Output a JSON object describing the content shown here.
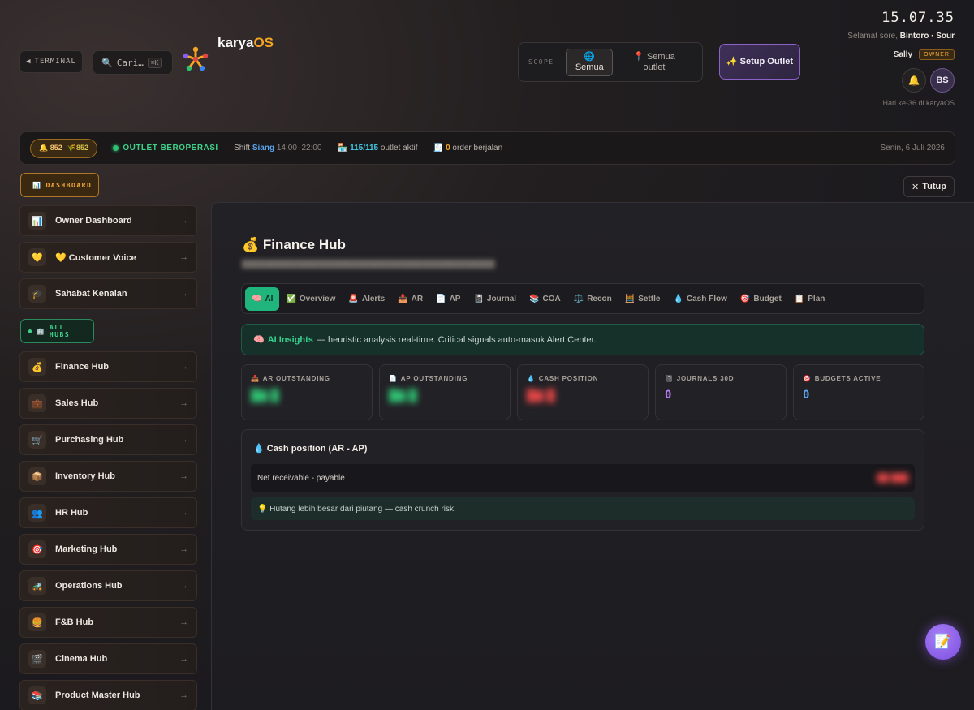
{
  "topbar": {
    "terminal_label": "TERMINAL",
    "terminal_icon": "◀",
    "search_placeholder": "Cari…",
    "search_shortcut": "⌘K",
    "brand_prefix": "karya",
    "brand_suffix": "OS",
    "scope": {
      "label": "SCOPE",
      "all_icon": "🌐",
      "all_label": "Semua",
      "outlet_icon": "📍",
      "outlet_label": "Semua outlet"
    },
    "setup_label": "✨ Setup Outlet",
    "clock": "15.07.35",
    "greeting_prefix": "Selamat sore,",
    "greeting_location": "Bintoro · Sour",
    "user_name": "Sally",
    "role_badge": "OWNER",
    "bell_icon": "🔔",
    "avatar_initials": "BS",
    "day_count": "Hari ke-36 di karyaOS"
  },
  "status": {
    "points_a": "🔔 852",
    "points_b": "🌾852",
    "operating": "OUTLET BEROPERASI",
    "shift_prefix": "Shift",
    "shift_name": "Siang",
    "shift_time": "14:00–22:00",
    "outlet_icon": "🏪",
    "outlet_count": "115/115",
    "outlet_suffix": "outlet aktif",
    "order_icon": "🧾",
    "order_count": "0",
    "order_suffix": "order berjalan",
    "date": "Senin, 6 Juli 2026"
  },
  "sidebar": {
    "dashboard_section": "DASHBOARD",
    "dashboard_section_icon": "📊",
    "dashboard_items": [
      {
        "icon": "📊",
        "label": "Owner Dashboard"
      },
      {
        "icon": "💛",
        "label": "💛 Customer Voice"
      },
      {
        "icon": "🎓",
        "label": "Sahabat Kenalan"
      }
    ],
    "hubs_section": "ALL HUBS",
    "hubs_section_icon": "🏢",
    "hubs": [
      {
        "icon": "💰",
        "label": "Finance Hub"
      },
      {
        "icon": "💼",
        "label": "Sales Hub"
      },
      {
        "icon": "🛒",
        "label": "Purchasing Hub"
      },
      {
        "icon": "📦",
        "label": "Inventory Hub"
      },
      {
        "icon": "👥",
        "label": "HR Hub"
      },
      {
        "icon": "🎯",
        "label": "Marketing Hub"
      },
      {
        "icon": "🚜",
        "label": "Operations Hub"
      },
      {
        "icon": "🍔",
        "label": "F&B Hub"
      },
      {
        "icon": "🎬",
        "label": "Cinema Hub"
      },
      {
        "icon": "📚",
        "label": "Product Master Hub"
      }
    ],
    "arrow": "→"
  },
  "main": {
    "close_label": "Tutup",
    "title": "💰 Finance Hub",
    "tabs": [
      {
        "icon": "🧠",
        "label": "AI"
      },
      {
        "icon": "✅",
        "label": "Overview"
      },
      {
        "icon": "🚨",
        "label": "Alerts"
      },
      {
        "icon": "📥",
        "label": "AR"
      },
      {
        "icon": "📄",
        "label": "AP"
      },
      {
        "icon": "📓",
        "label": "Journal"
      },
      {
        "icon": "📚",
        "label": "COA"
      },
      {
        "icon": "⚖️",
        "label": "Recon"
      },
      {
        "icon": "🧮",
        "label": "Settle"
      },
      {
        "icon": "💧",
        "label": "Cash Flow"
      },
      {
        "icon": "🎯",
        "label": "Budget"
      },
      {
        "icon": "📋",
        "label": "Plan"
      }
    ],
    "insight_icon": "🧠",
    "insight_title": "AI Insights",
    "insight_text": "— heuristic analysis real-time. Critical signals auto-masuk Alert Center.",
    "kpis": [
      {
        "icon": "📥",
        "label": "AR OUTSTANDING",
        "value": "",
        "color": "#2fbf71"
      },
      {
        "icon": "📄",
        "label": "AP OUTSTANDING",
        "value": "",
        "color": "#2fbf71"
      },
      {
        "icon": "💧",
        "label": "CASH POSITION",
        "value": "",
        "color": "#e04545"
      },
      {
        "icon": "📓",
        "label": "JOURNALS 30D",
        "value": "0",
        "color": "#b77cf2"
      },
      {
        "icon": "🎯",
        "label": "BUDGETS ACTIVE",
        "value": "0",
        "color": "#5aa6f0"
      }
    ],
    "cash_card": {
      "title": "💧 Cash position (AR - AP)",
      "row_label": "Net receivable - payable",
      "note": "💡 Hutang lebih besar dari piutang — cash crunch risk."
    }
  },
  "fab_icon": "📝"
}
